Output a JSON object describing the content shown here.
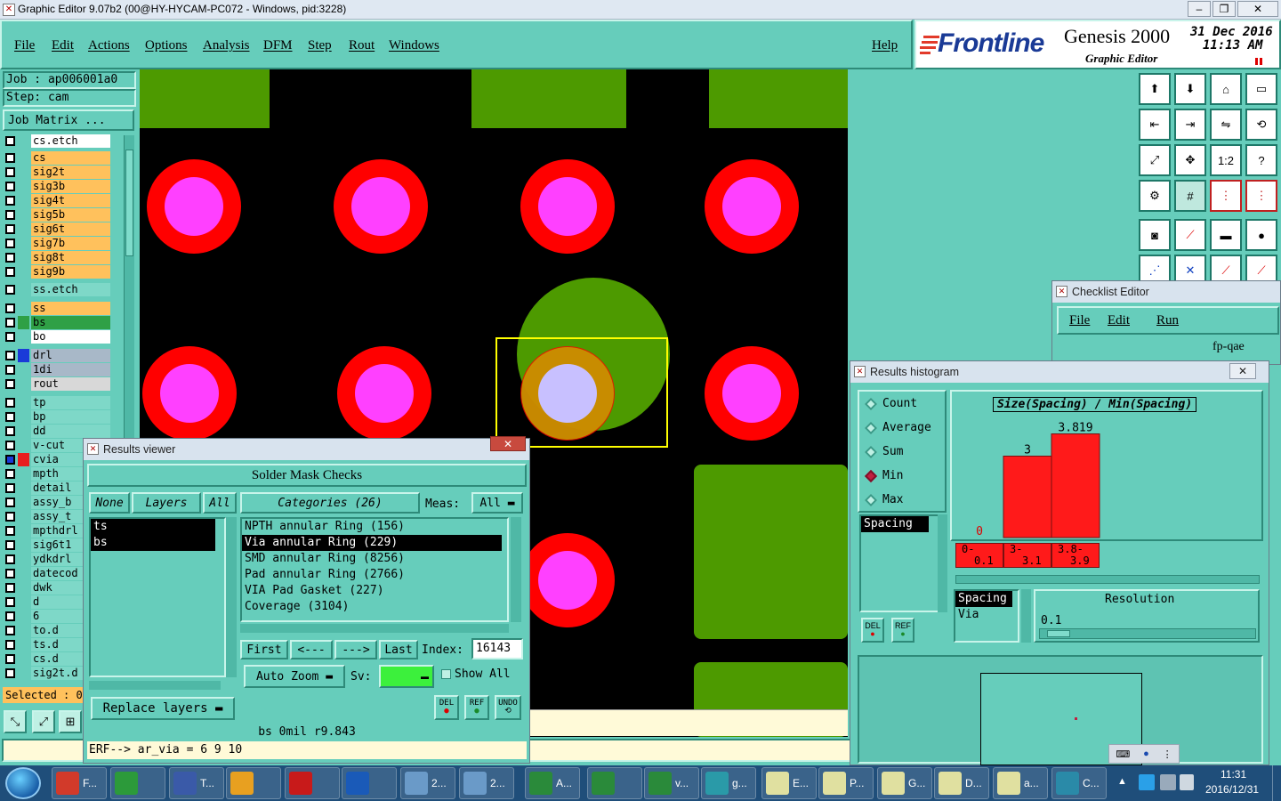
{
  "window": {
    "title": "Graphic Editor 9.07b2 (00@HY-HYCAM-PC072 - Windows, pid:3228)"
  },
  "menu": {
    "items": [
      "File",
      "Edit",
      "Actions",
      "Options",
      "Analysis",
      "DFM",
      "Step",
      "Rout",
      "Windows"
    ],
    "help": "Help"
  },
  "brand": {
    "logo": "Frontline",
    "product": "Genesis 2000",
    "subtitle": "Graphic Editor",
    "date": "31 Dec 2016",
    "time": "11:13 AM"
  },
  "job": {
    "job_label": "Job  : ap006001a0",
    "step_label": "Step: cam",
    "matrix_button": "Job Matrix ..."
  },
  "layers": [
    {
      "name": "cs.etch",
      "color": "#ffffff"
    },
    {
      "name": "cs",
      "color": "#FFC15C"
    },
    {
      "name": "sig2t",
      "color": "#FFC15C"
    },
    {
      "name": "sig3b",
      "color": "#FFC15C"
    },
    {
      "name": "sig4t",
      "color": "#FFC15C"
    },
    {
      "name": "sig5b",
      "color": "#FFC15C"
    },
    {
      "name": "sig6t",
      "color": "#FFC15C"
    },
    {
      "name": "sig7b",
      "color": "#FFC15C"
    },
    {
      "name": "sig8t",
      "color": "#FFC15C"
    },
    {
      "name": "sig9b",
      "color": "#FFC15C"
    },
    {
      "name": "ss.etch",
      "color": "#7ED8C8"
    },
    {
      "name": "ss",
      "color": "#FFC15C"
    },
    {
      "name": "bs",
      "color": "#2FA046"
    },
    {
      "name": "bo",
      "color": "#ffffff"
    },
    {
      "name": "drl",
      "color": "#A8B8C8"
    },
    {
      "name": "1di",
      "color": "#A8B8C8"
    },
    {
      "name": "rout",
      "color": "#D8D8D8"
    },
    {
      "name": "tp",
      "color": "#7ED8C8"
    },
    {
      "name": "bp",
      "color": "#7ED8C8"
    },
    {
      "name": "dd",
      "color": "#7ED8C8"
    },
    {
      "name": "v-cut",
      "color": "#7ED8C8"
    },
    {
      "name": "cvia",
      "color": "#7ED8C8"
    },
    {
      "name": "mpth",
      "color": "#7ED8C8"
    },
    {
      "name": "detail",
      "color": "#7ED8C8"
    },
    {
      "name": "assy_b",
      "color": "#7ED8C8"
    },
    {
      "name": "assy_t",
      "color": "#7ED8C8"
    },
    {
      "name": "mpthdrl",
      "color": "#7ED8C8"
    },
    {
      "name": "sig6t1",
      "color": "#7ED8C8"
    },
    {
      "name": "ydkdrl",
      "color": "#7ED8C8"
    },
    {
      "name": "datecod",
      "color": "#7ED8C8"
    },
    {
      "name": "dwk",
      "color": "#7ED8C8"
    },
    {
      "name": "d",
      "color": "#7ED8C8"
    },
    {
      "name": "6",
      "color": "#7ED8C8"
    },
    {
      "name": "to.d",
      "color": "#7ED8C8"
    },
    {
      "name": "ts.d",
      "color": "#7ED8C8"
    },
    {
      "name": "cs.d",
      "color": "#7ED8C8"
    },
    {
      "name": "sig2t.d",
      "color": "#7ED8C8"
    }
  ],
  "selected_label": "Selected : 0",
  "results_viewer": {
    "title": "Results viewer",
    "heading": "Solder Mask Checks",
    "none": "None",
    "layers": "Layers",
    "all": "All",
    "layer_list": [
      "ts",
      "bs"
    ],
    "categories_label": "Categories (26)",
    "meas_label": "Meas:",
    "meas_value": "All",
    "categories": [
      "NPTH annular Ring (156)",
      "Via annular Ring (229)",
      "SMD annular Ring (8256)",
      "Pad annular Ring (2766)",
      "VIA Pad Gasket (227)",
      "Coverage (3104)"
    ],
    "first": "First",
    "prev": "<---",
    "next": "--->",
    "last": "Last",
    "index_label": "Index:",
    "index_value": "16143",
    "auto_zoom": "Auto Zoom",
    "sv_label": "Sv:",
    "show_all": "Show All",
    "replace_layers": "Replace layers",
    "del": "DEL",
    "ref": "REF",
    "undo": "UNDO",
    "status": "bs  0mil   r9.843"
  },
  "erf_line": "ERF--> ar_via = 6 9 10",
  "checklist_editor": {
    "title": "Checklist Editor",
    "menu": [
      "File",
      "Edit",
      "Run"
    ],
    "name": "fp-qae"
  },
  "histogram": {
    "title": "Results histogram",
    "modes": [
      "Count",
      "Average",
      "Sum",
      "Min",
      "Max"
    ],
    "selected_mode": "Min",
    "measure_list": [
      "Spacing"
    ],
    "del": "DEL",
    "ref": "REF",
    "chart_title": "Size(Spacing) / Min(Spacing)",
    "bins": [
      {
        "range": "0-0.1",
        "low": "0-",
        "high": "0.1",
        "value": 0
      },
      {
        "range": "3-3.1",
        "low": "3-",
        "high": "3.1",
        "value": 3
      },
      {
        "range": "3.8-3.9",
        "low": "3.8-",
        "high": "3.9",
        "value": 3.819
      }
    ],
    "type_list": [
      "Spacing",
      "Via"
    ],
    "resolution_label": "Resolution",
    "resolution_value": "0.1"
  },
  "clock": {
    "time": "11:31",
    "date": "2016/12/31"
  },
  "taskbar": [
    "F...",
    "",
    "T...",
    "",
    "",
    "",
    "2...",
    "2...",
    "A...",
    "",
    "v...",
    "g...",
    "E...",
    "P...",
    "G...",
    "D...",
    "a...",
    "C..."
  ]
}
